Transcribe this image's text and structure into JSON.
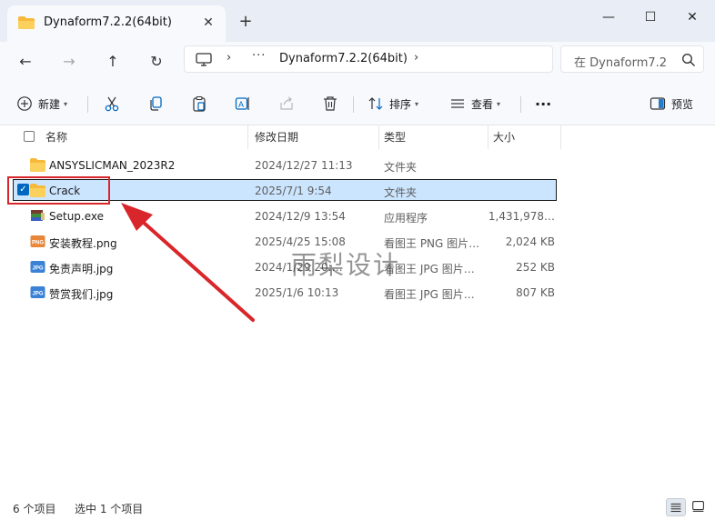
{
  "window": {
    "tab_title": "Dynaform7.2.2(64bit)",
    "tab_close": "✕",
    "new_tab": "+",
    "minimize": "—",
    "maximize": "☐",
    "close": "✕"
  },
  "nav": {
    "back": "←",
    "forward": "→",
    "up": "↑",
    "refresh": "↻"
  },
  "address": {
    "more": "···",
    "crumb": "Dynaform7.2.2(64bit)",
    "sep1": "›",
    "sep2": "›"
  },
  "search": {
    "placeholder": "在 Dynaform7.2"
  },
  "toolbar": {
    "new_label": "新建",
    "sort_label": "排序",
    "view_label": "查看",
    "more_label": "···",
    "preview_label": "预览"
  },
  "columns": {
    "name": "名称",
    "modified": "修改日期",
    "type": "类型",
    "size": "大小"
  },
  "files": [
    {
      "name": "ANSYSLICMAN_2023R2",
      "date": "2024/12/27 11:13",
      "type": "文件夹",
      "size": "",
      "icon": "folder-icon"
    },
    {
      "name": "Crack",
      "date": "2025/7/1 9:54",
      "type": "文件夹",
      "size": "",
      "icon": "folder-icon",
      "selected": true
    },
    {
      "name": "Setup.exe",
      "date": "2024/12/9 13:54",
      "type": "应用程序",
      "size": "1,431,978…",
      "icon": "installer-icon"
    },
    {
      "name": "安装教程.png",
      "date": "2025/4/25 15:08",
      "type": "看图王 PNG 图片…",
      "size": "2,024 KB",
      "icon": "png-file-icon"
    },
    {
      "name": "免责声明.jpg",
      "date": "2024/1/29 20:…",
      "type": "看图王 JPG 图片…",
      "size": "252 KB",
      "icon": "jpg-file-icon"
    },
    {
      "name": "赞赏我们.jpg",
      "date": "2025/1/6 10:13",
      "type": "看图王 JPG 图片…",
      "size": "807 KB",
      "icon": "jpg-file-icon"
    }
  ],
  "watermark": "雨梨设计",
  "status": {
    "count": "6 个项目",
    "selected": "选中 1 个项目"
  },
  "colors": {
    "accent": "#0067c0",
    "selection": "#cce5ff",
    "annotation": "#d9262a",
    "folder": "#f8c846"
  }
}
